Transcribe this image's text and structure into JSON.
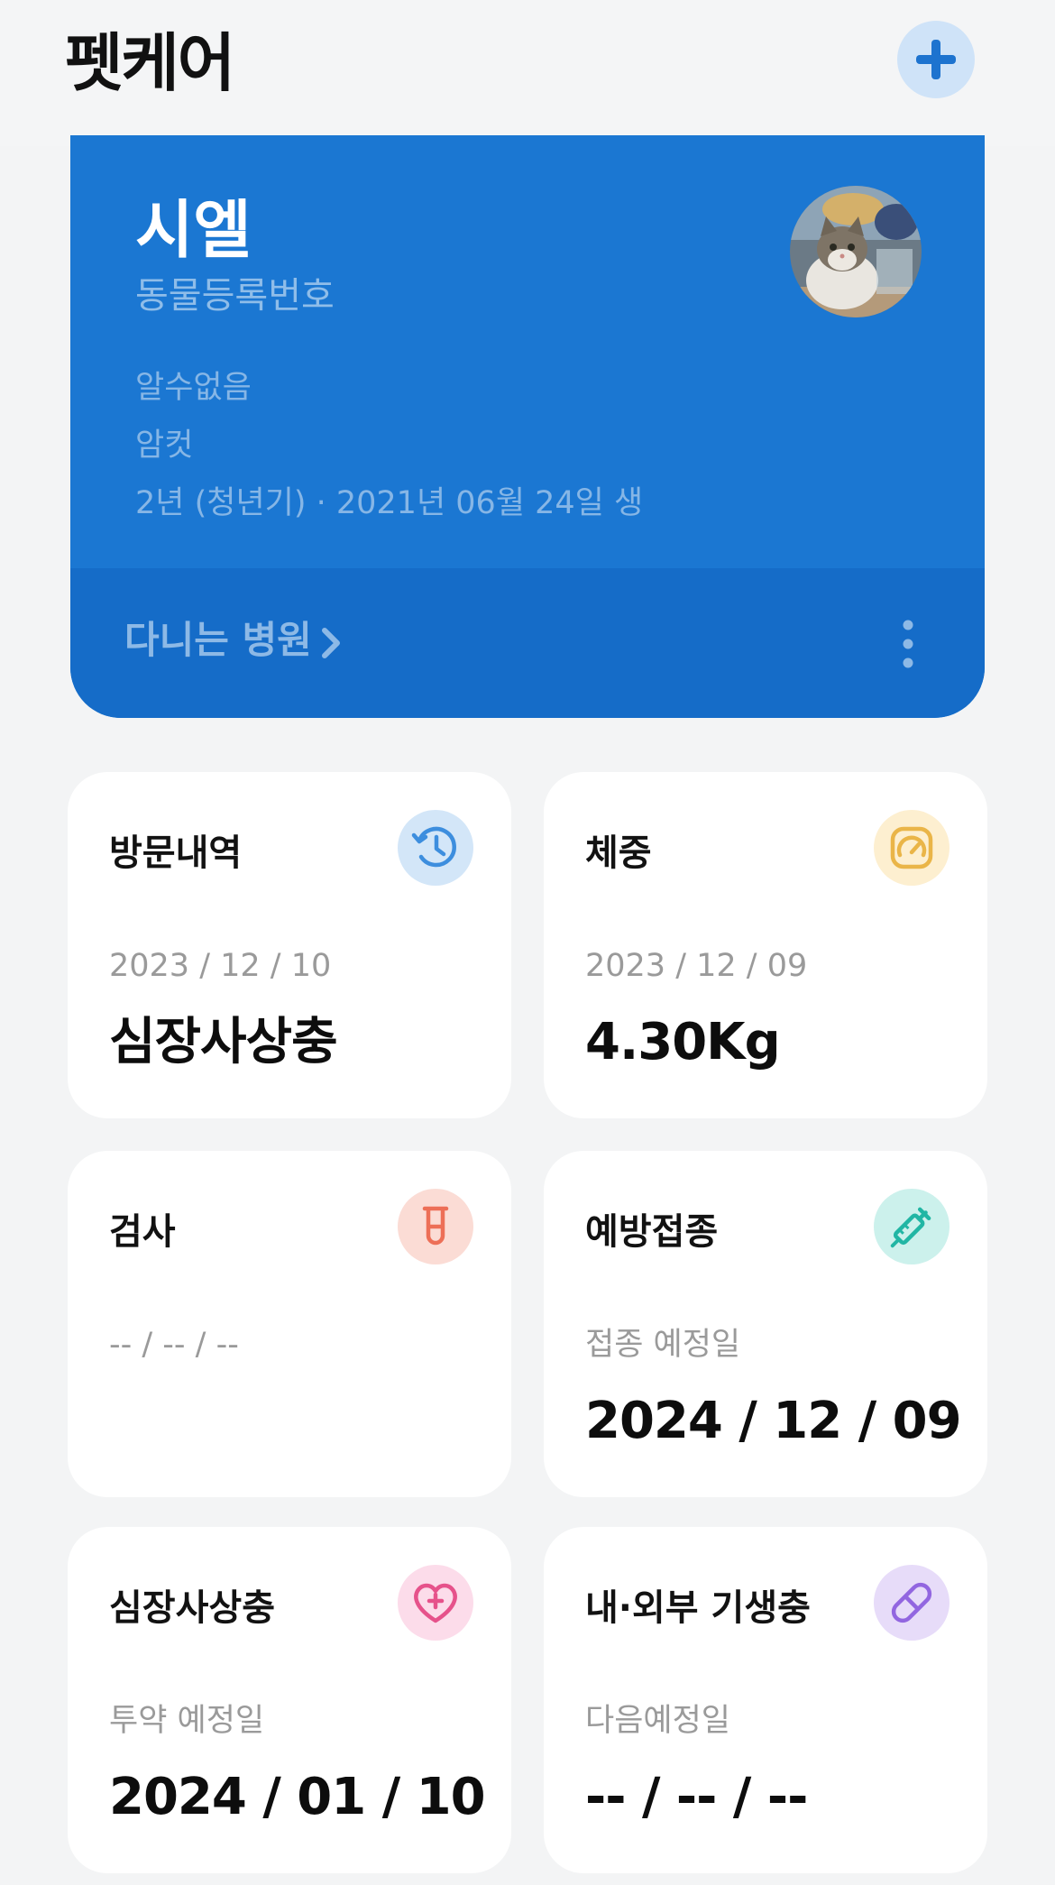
{
  "app": {
    "title": "펫케어"
  },
  "pet": {
    "name": "시엘",
    "registration_label": "동물등록번호",
    "breed": "알수없음",
    "sex": "암컷",
    "age_birth": "2년 (청년기) · 2021년 06월 24일 생",
    "hospital_link": "다니는 병원"
  },
  "tiles": [
    {
      "title": "방문내역",
      "sub": "2023 / 12 / 10",
      "value": "심장사상충",
      "icon": "history-icon",
      "icon_bg": "#d3e6f8",
      "icon_color": "#3d8ede"
    },
    {
      "title": "체중",
      "sub": "2023 / 12 / 09",
      "value": "4.30Kg",
      "icon": "gauge-icon",
      "icon_bg": "#fdefd0",
      "icon_color": "#eab548"
    },
    {
      "title": "검사",
      "sub": "-- / -- / --",
      "value": "",
      "icon": "test-tube-icon",
      "icon_bg": "#fbdcd5",
      "icon_color": "#ed6f57"
    },
    {
      "title": "예방접종",
      "sub": "접종 예정일",
      "value": "2024 / 12 / 09",
      "icon": "syringe-icon",
      "icon_bg": "#ccf1ec",
      "icon_color": "#21b6a4"
    },
    {
      "title": "심장사상충",
      "sub": "투약 예정일",
      "value": "2024 / 01 / 10",
      "icon": "heart-plus-icon",
      "icon_bg": "#fcdcea",
      "icon_color": "#e6528b"
    },
    {
      "title": "내·외부 기생충",
      "sub": "다음예정일",
      "value": "-- / -- / --",
      "icon": "pill-icon",
      "icon_bg": "#e7dcf9",
      "icon_color": "#9266e0"
    }
  ]
}
